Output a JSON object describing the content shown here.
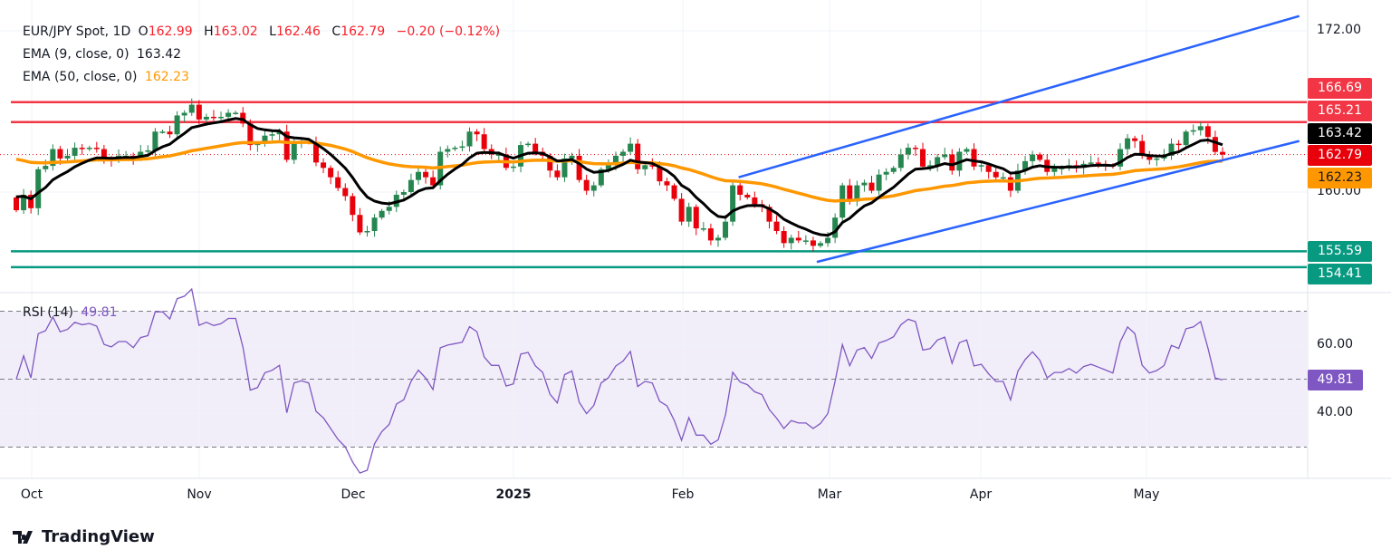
{
  "header": {
    "symbol": "EUR/JPY Spot, 1D",
    "o_label": "O",
    "open": "162.99",
    "h_label": "H",
    "high": "163.02",
    "l_label": "L",
    "low": "162.46",
    "c_label": "C",
    "close": "162.79",
    "change": "−0.20 (−0.12%)"
  },
  "indicators": {
    "ema9_label": "EMA (9, close, 0)",
    "ema9_value": "163.42",
    "ema50_label": "EMA (50, close, 0)",
    "ema50_value": "162.23",
    "rsi_label": "RSI (14)",
    "rsi_value": "49.81"
  },
  "price_axis": {
    "ticks": [
      "172.00",
      "160.00"
    ]
  },
  "rsi_axis": {
    "ticks": [
      "60.00",
      "40.00"
    ]
  },
  "price_tags": {
    "resistance_1": "166.69",
    "resistance_2": "165.21",
    "ema9": "163.42",
    "last": "162.79",
    "ema50": "162.23",
    "support_1": "155.59",
    "support_2": "154.41",
    "rsi": "49.81"
  },
  "time_axis": {
    "labels": [
      "Oct",
      "Nov",
      "Dec",
      "2025",
      "Feb",
      "Mar",
      "Apr",
      "May"
    ]
  },
  "brand": "TradingView",
  "colors": {
    "up": "#26864f",
    "down": "#e8000b",
    "ema9": "#000000",
    "ema50": "#ff9800",
    "trend": "#2962ff",
    "resistance": "#f23645",
    "support": "#089981",
    "rsi": "#7e57c2"
  },
  "chart_data": {
    "type": "candlestick",
    "title": "EUR/JPY Spot, 1D",
    "ylim": [
      153.5,
      173.5
    ],
    "closes": [
      158.65,
      159.8,
      158.8,
      161.7,
      161.95,
      163.2,
      162.5,
      162.7,
      163.3,
      163.2,
      163.3,
      163.2,
      162.5,
      162.4,
      162.7,
      162.7,
      162.5,
      163.0,
      163.1,
      164.5,
      164.5,
      164.3,
      165.7,
      165.9,
      166.5,
      165.4,
      165.6,
      165.5,
      165.6,
      165.9,
      165.9,
      165.1,
      163.5,
      163.6,
      164.2,
      164.3,
      164.5,
      162.4,
      163.7,
      163.8,
      163.7,
      162.2,
      161.8,
      161.1,
      160.3,
      159.7,
      158.3,
      157.0,
      157.1,
      158.1,
      158.6,
      158.9,
      159.8,
      160.0,
      160.9,
      161.5,
      161.1,
      160.5,
      163.0,
      163.2,
      163.3,
      163.4,
      164.5,
      164.3,
      163.2,
      162.8,
      162.8,
      161.8,
      161.9,
      163.5,
      163.6,
      163.0,
      162.7,
      161.6,
      161.1,
      162.5,
      162.7,
      160.9,
      160.1,
      160.5,
      161.7,
      162.0,
      162.7,
      163.0,
      163.6,
      161.7,
      162.0,
      161.9,
      160.8,
      160.5,
      159.5,
      157.8,
      158.9,
      157.3,
      157.3,
      156.4,
      156.6,
      157.8,
      160.5,
      159.8,
      159.6,
      159.1,
      158.9,
      157.8,
      157.1,
      156.2,
      156.6,
      156.4,
      156.4,
      156.0,
      156.2,
      156.6,
      158.1,
      160.5,
      159.3,
      160.5,
      160.7,
      160.1,
      161.3,
      161.5,
      161.8,
      162.8,
      163.3,
      163.2,
      161.9,
      162.0,
      162.6,
      162.8,
      161.6,
      163.0,
      163.2,
      161.9,
      162.0,
      161.5,
      161.1,
      161.1,
      160.1,
      161.6,
      162.3,
      162.8,
      162.4,
      161.5,
      161.8,
      161.8,
      162.0,
      161.8,
      162.1,
      162.2,
      162.1,
      162.0,
      161.9,
      163.2,
      164.0,
      163.8,
      162.7,
      162.4,
      162.5,
      162.7,
      163.6,
      163.5,
      164.5,
      164.6,
      164.9,
      164.1,
      162.99,
      162.79
    ],
    "first_open": 159.6,
    "ema9_start": 159.9,
    "ema50_start": 162.6,
    "horizontal_levels": [
      {
        "name": "resistance",
        "price": 166.69
      },
      {
        "name": "resistance",
        "price": 165.21
      },
      {
        "name": "support",
        "price": 155.59
      },
      {
        "name": "support",
        "price": 154.41
      }
    ],
    "trendlines": [
      {
        "name": "channel-upper",
        "from_bar": 98.8,
        "from_price": 161.1,
        "to_bar": 175.5,
        "to_price": 173.1
      },
      {
        "name": "channel-lower",
        "from_bar": 109.5,
        "from_price": 154.8,
        "to_bar": 175.5,
        "to_price": 163.8
      }
    ],
    "rsi": {
      "period": 14,
      "last": 49.81,
      "bands": [
        70,
        50,
        30
      ],
      "ylim": [
        25,
        75
      ]
    }
  }
}
